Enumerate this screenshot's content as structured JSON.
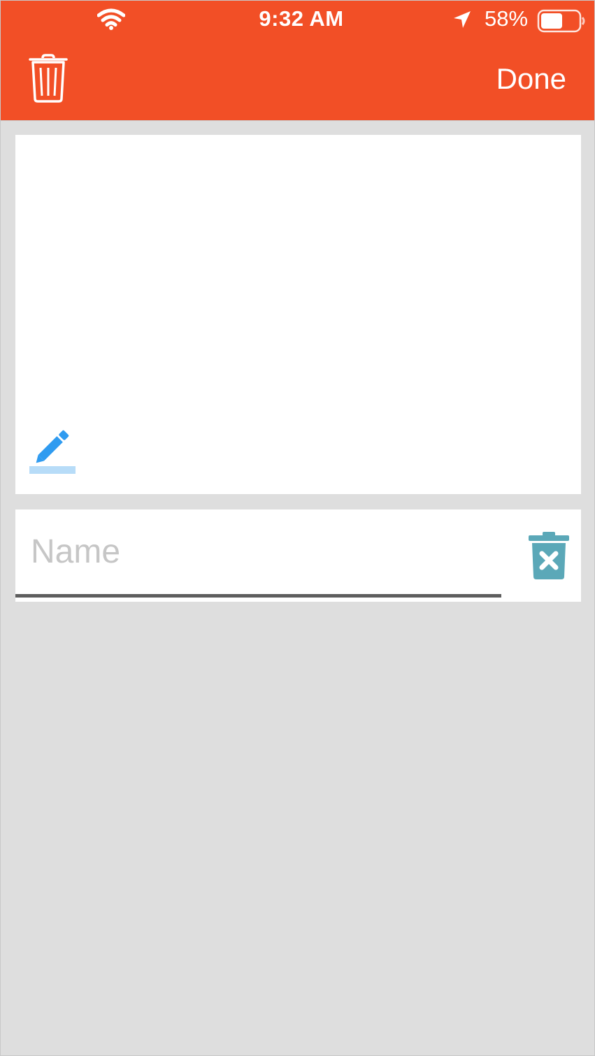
{
  "status_bar": {
    "time": "9:32 AM",
    "battery_percent": "58%",
    "battery_level": 0.58
  },
  "header": {
    "delete_icon": "trash-icon",
    "done_label": "Done"
  },
  "canvas": {
    "tool_icon": "pencil-icon"
  },
  "name_field": {
    "value": "",
    "placeholder": "Name",
    "clear_icon": "trash-x-icon"
  },
  "colors": {
    "header": "#f24f26",
    "background": "#dedede",
    "pencil": "#2f9bf0",
    "pencil_underline": "#b7dcf8",
    "delete_teal": "#5ba8b8"
  }
}
